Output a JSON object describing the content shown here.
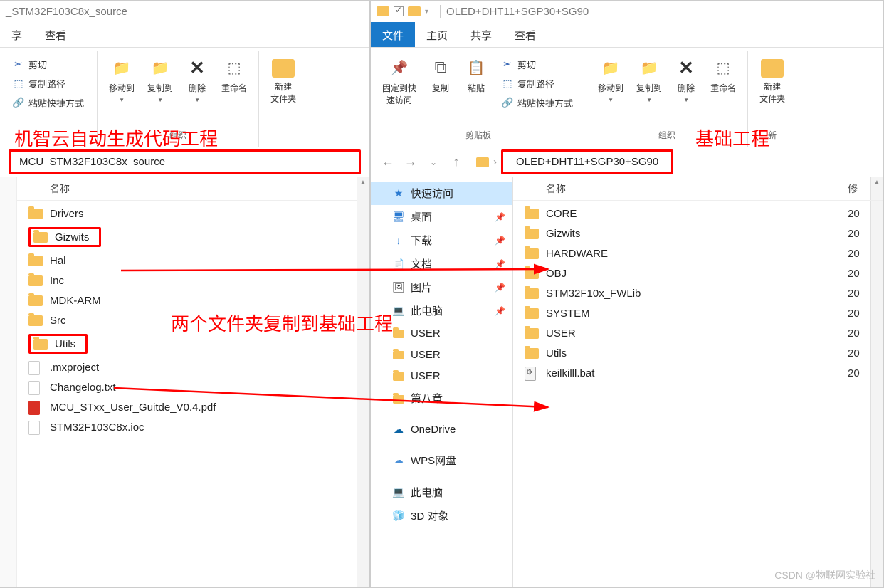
{
  "left": {
    "title": "_STM32F103C8x_source",
    "tabs": {
      "share": "享",
      "view": "查看"
    },
    "ribbon": {
      "cut": "剪切",
      "copypath": "复制路径",
      "pasteshortcut": "粘贴快捷方式",
      "moveto": "移动到",
      "copyto": "复制到",
      "delete": "删除",
      "rename": "重命名",
      "newfolder": "新建\n文件夹",
      "group_org": "组织"
    },
    "annotation": "机智云自动生成代码工程",
    "path": "MCU_STM32F103C8x_source",
    "cols": {
      "name": "名称"
    },
    "items": [
      {
        "name": "Drivers",
        "type": "folder"
      },
      {
        "name": "Gizwits",
        "type": "folder",
        "highlight": true
      },
      {
        "name": "Hal",
        "type": "folder"
      },
      {
        "name": "Inc",
        "type": "folder"
      },
      {
        "name": "MDK-ARM",
        "type": "folder"
      },
      {
        "name": "Src",
        "type": "folder"
      },
      {
        "name": "Utils",
        "type": "folder",
        "highlight": true
      },
      {
        "name": ".mxproject",
        "type": "doc"
      },
      {
        "name": "Changelog.txt",
        "type": "doc"
      },
      {
        "name": "MCU_STxx_User_Guitde_V0.4.pdf",
        "type": "pdf"
      },
      {
        "name": "STM32F103C8x.ioc",
        "type": "doc"
      }
    ]
  },
  "right": {
    "title": "OLED+DHT11+SGP30+SG90",
    "tabs": {
      "file": "文件",
      "home": "主页",
      "share": "共享",
      "view": "查看"
    },
    "ribbon": {
      "pinquick": "固定到快\n速访问",
      "copy": "复制",
      "paste": "粘贴",
      "cut": "剪切",
      "copypath": "复制路径",
      "pasteshortcut": "粘贴快捷方式",
      "moveto": "移动到",
      "copyto": "复制到",
      "delete": "删除",
      "rename": "重命名",
      "newfolder": "新建\n文件夹",
      "group_clip": "剪贴板",
      "group_org": "组织",
      "group_new": "新"
    },
    "annotation": "基础工程",
    "path": "OLED+DHT11+SGP30+SG90",
    "sidebar": [
      {
        "name": "快速访问",
        "icon": "★",
        "active": true,
        "color": "#2a7ad1"
      },
      {
        "name": "桌面",
        "icon": "🖥",
        "pin": true,
        "color": "#2a7ad1"
      },
      {
        "name": "下载",
        "icon": "↓",
        "pin": true,
        "color": "#2a7ad1"
      },
      {
        "name": "文档",
        "icon": "📄",
        "pin": true
      },
      {
        "name": "图片",
        "icon": "🖼",
        "pin": true
      },
      {
        "name": "此电脑",
        "icon": "💻",
        "pin": true
      },
      {
        "name": "USER",
        "icon": "folder"
      },
      {
        "name": "USER",
        "icon": "folder"
      },
      {
        "name": "USER",
        "icon": "folder"
      },
      {
        "name": "第八章",
        "icon": "folder"
      },
      {
        "sep": true
      },
      {
        "name": "OneDrive",
        "icon": "☁",
        "color": "#0a64a4"
      },
      {
        "sep": true
      },
      {
        "name": "WPS网盘",
        "icon": "☁",
        "color": "#4a90d9"
      },
      {
        "sep": true
      },
      {
        "name": "此电脑",
        "icon": "💻"
      },
      {
        "name": "3D 对象",
        "icon": "🧊"
      }
    ],
    "cols": {
      "name": "名称",
      "date": "修"
    },
    "items": [
      {
        "name": "CORE",
        "type": "folder",
        "date": "20"
      },
      {
        "name": "Gizwits",
        "type": "folder",
        "date": "20"
      },
      {
        "name": "HARDWARE",
        "type": "folder",
        "date": "20"
      },
      {
        "name": "OBJ",
        "type": "folder",
        "date": "20"
      },
      {
        "name": "STM32F10x_FWLib",
        "type": "folder",
        "date": "20"
      },
      {
        "name": "SYSTEM",
        "type": "folder",
        "date": "20"
      },
      {
        "name": "USER",
        "type": "folder",
        "date": "20"
      },
      {
        "name": "Utils",
        "type": "folder",
        "date": "20"
      },
      {
        "name": "keilkilll.bat",
        "type": "bat",
        "date": "20"
      }
    ]
  },
  "center_annotation": "两个文件夹复制到基础工程",
  "watermark": "CSDN @物联网实验社"
}
